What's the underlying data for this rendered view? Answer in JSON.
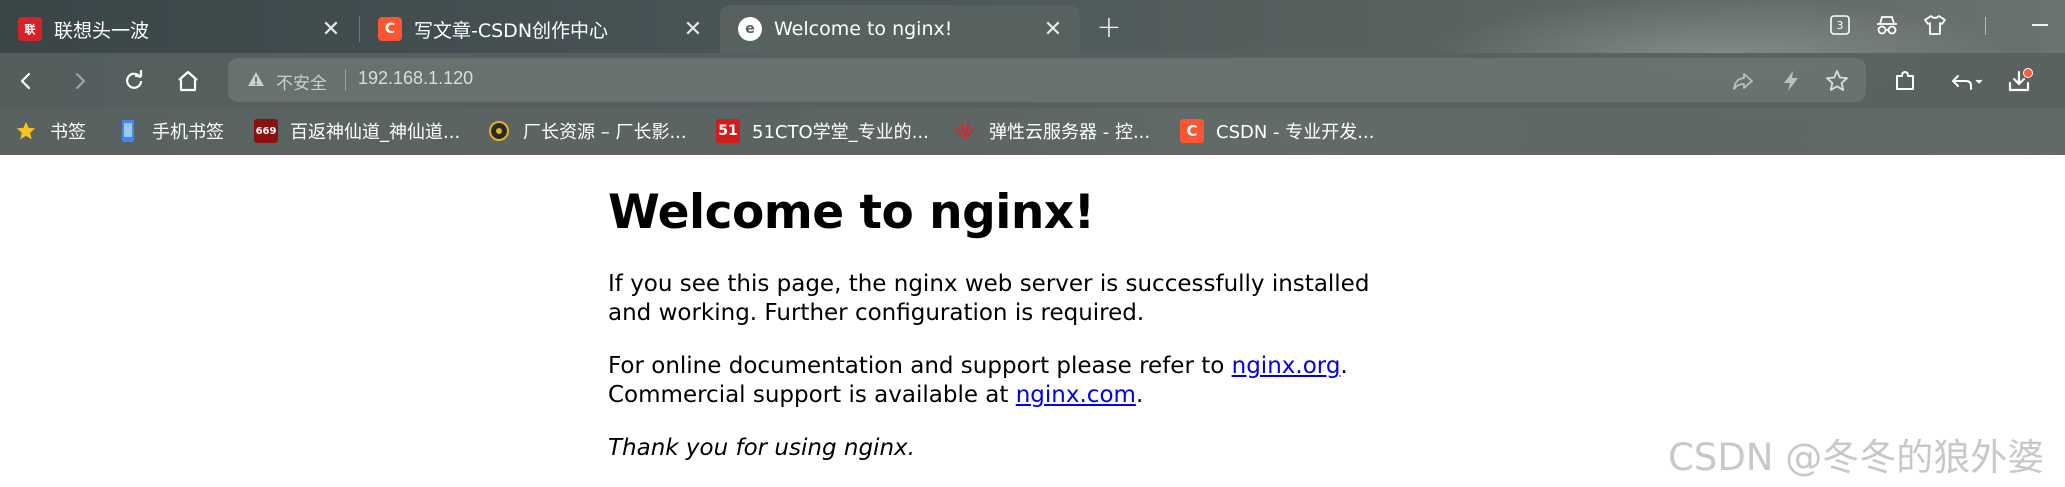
{
  "tabs": [
    {
      "title": "联想头一波",
      "favicon": "联想",
      "favicon_color": "#d4242a"
    },
    {
      "title": "写文章-CSDN创作中心",
      "favicon": "C",
      "favicon_color": "#fc5531"
    },
    {
      "title": "Welcome to nginx!",
      "favicon": "e",
      "favicon_color": "#ffffff",
      "active": true
    }
  ],
  "toolbar": {
    "security_label": "不安全",
    "url": "192.168.1.120",
    "tab_count": "3"
  },
  "bookmarks": [
    {
      "label": "书签",
      "icon": "star-icon"
    },
    {
      "label": "手机书签",
      "icon": "phone-icon"
    },
    {
      "label": "百返神仙道_神仙道...",
      "icon": "669yc-icon",
      "icon_text": "669"
    },
    {
      "label": "厂长资源 – 厂长影...",
      "icon": "movie-icon"
    },
    {
      "label": "51CTO学堂_专业的...",
      "icon": "51cto-icon",
      "icon_text": "51"
    },
    {
      "label": "弹性云服务器 - 控...",
      "icon": "huawei-icon"
    },
    {
      "label": "CSDN - 专业开发...",
      "icon": "csdn-icon",
      "icon_text": "C"
    }
  ],
  "page": {
    "heading": "Welcome to nginx!",
    "para1": "If you see this page, the nginx web server is successfully installed and working. Further configuration is required.",
    "para2_prefix": "For online documentation and support please refer to ",
    "link_org": "nginx.org",
    "para2_mid": ".",
    "para2_line2_prefix": "Commercial support is available at ",
    "link_com": "nginx.com",
    "para2_end": ".",
    "thanks": "Thank you for using nginx."
  },
  "watermark": "CSDN @冬冬的狼外婆",
  "colors": {
    "link": "#0000ee",
    "csdn_orange": "#fc5531",
    "download_badge": "#ff5a36"
  }
}
